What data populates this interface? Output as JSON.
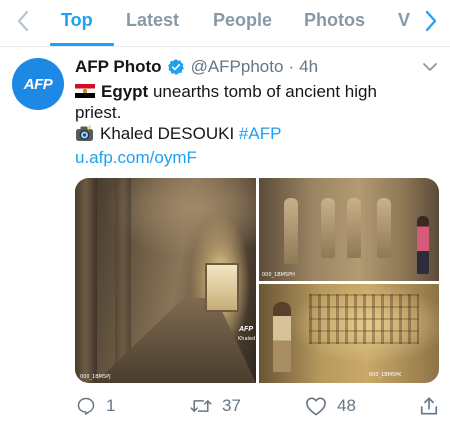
{
  "tabs": [
    {
      "label": "Top",
      "active": true
    },
    {
      "label": "Latest",
      "active": false
    },
    {
      "label": "People",
      "active": false
    },
    {
      "label": "Photos",
      "active": false
    },
    {
      "label": "V",
      "active": false
    }
  ],
  "tweet": {
    "avatar_text": "AFP",
    "display_name": "AFP Photo",
    "verified": true,
    "handle": "@AFPphoto",
    "separator": "·",
    "time": "4h",
    "body": {
      "flag_icon": "egypt-flag",
      "country": "Egypt",
      "line1_rest": "unearths tomb of ancient high",
      "line2": "priest.",
      "camera_icon": "camera-with-flash",
      "photographer": "Khaled DESOUKI",
      "hashtag": "#AFP",
      "link": "u.afp.com/oymF"
    },
    "media": {
      "credit_left": "000_1BM5PJ",
      "credit_top_right": "000_1BM5PH",
      "credit_bottom_right": "000_1BM5PK",
      "watermark": "AFP",
      "watermark_credit": "Khaled"
    },
    "actions": {
      "replies": "1",
      "retweets": "37",
      "likes": "48"
    }
  },
  "colors": {
    "accent": "#1da1f2",
    "muted": "#657786",
    "tab_inactive": "#8899a6",
    "avatar": "#1e88e5"
  }
}
